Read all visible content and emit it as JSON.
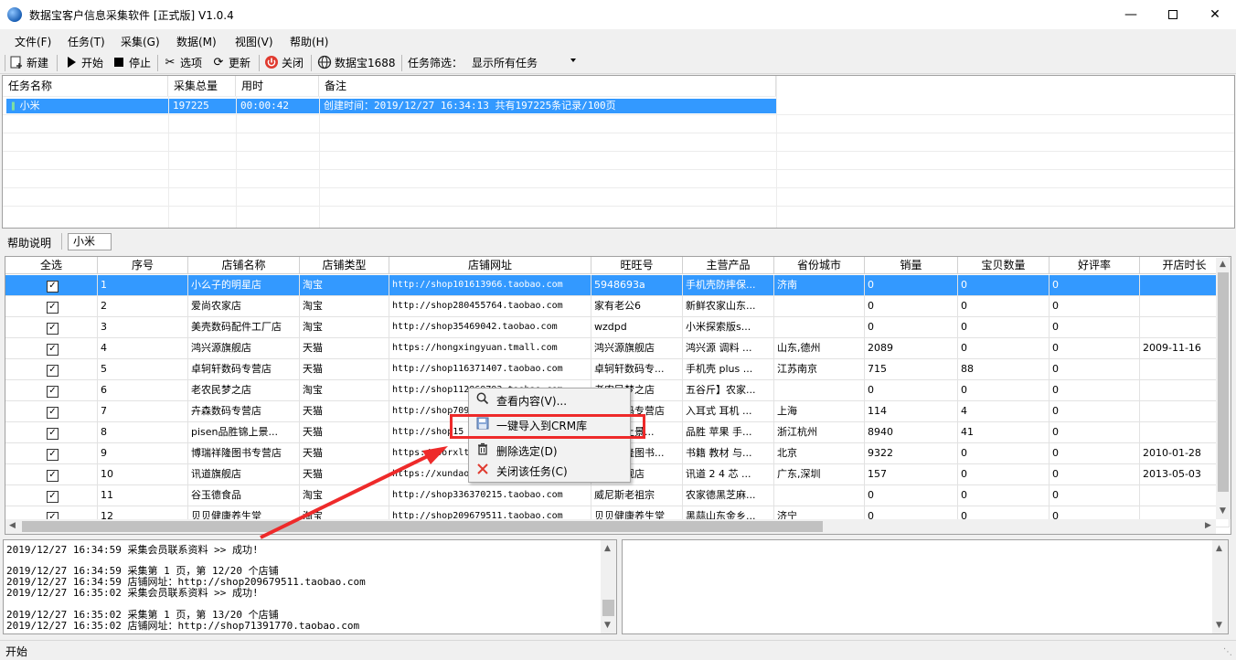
{
  "window": {
    "title": "数据宝客户信息采集软件 [正式版] V1.0.4"
  },
  "menu": [
    "文件(F)",
    "任务(T)",
    "采集(G)",
    "数据(M)",
    "视图(V)",
    "帮助(H)"
  ],
  "toolbar": {
    "new": "新建",
    "start": "开始",
    "stop": "停止",
    "options": "选项",
    "update": "更新",
    "close": "关闭",
    "site": "数据宝1688",
    "filter_label": "任务筛选：",
    "filter_value": "显示所有任务"
  },
  "task_table": {
    "headers": [
      "任务名称",
      "采集总量",
      "用时",
      "备注"
    ],
    "rows": [
      [
        "小米",
        "197225",
        "00:00:42",
        "创建时间：2019/12/27 16:34:13 共有197225条记录/100页"
      ]
    ]
  },
  "help": {
    "label": "帮助说明",
    "task": "小米"
  },
  "data_table": {
    "headers": [
      "全选",
      "序号",
      "店铺名称",
      "店铺类型",
      "店铺网址",
      "旺旺号",
      "主营产品",
      "省份城市",
      "销量",
      "宝贝数量",
      "好评率",
      "开店时长"
    ],
    "rows": [
      [
        "1",
        "小么子的明星店",
        "淘宝",
        "http://shop101613966.taobao.com",
        "5948693a",
        "手机壳防摔保...",
        "济南",
        "0",
        "0",
        "0",
        ""
      ],
      [
        "2",
        "爱尚农家店",
        "淘宝",
        "http://shop280455764.taobao.com",
        "家有老公6",
        "新鲜农家山东...",
        "",
        "0",
        "0",
        "0",
        ""
      ],
      [
        "3",
        "美壳数码配件工厂店",
        "淘宝",
        "http://shop35469042.taobao.com",
        "wzdpd",
        "小米探索版s...",
        "",
        "0",
        "0",
        "0",
        ""
      ],
      [
        "4",
        "鸿兴源旗舰店",
        "天猫",
        "https://hongxingyuan.tmall.com",
        "鸿兴源旗舰店",
        "鸿兴源 调料 ...",
        "山东,德州",
        "2089",
        "0",
        "0",
        "2009-11-16"
      ],
      [
        "5",
        "卓轲轩数码专营店",
        "天猫",
        "http://shop116371407.taobao.com",
        "卓轲轩数码专...",
        "手机壳 plus ...",
        "江苏南京",
        "715",
        "88",
        "0",
        ""
      ],
      [
        "6",
        "老农民梦之店",
        "淘宝",
        "http://shop112869793.taobao.com",
        "老农民梦之店",
        "五谷斤】农家...",
        "",
        "0",
        "0",
        "0",
        ""
      ],
      [
        "7",
        "卉森数码专营店",
        "天猫",
        "http://shop709",
        "卉森数码专营店",
        "入耳式 耳机 ...",
        "上海",
        "114",
        "4",
        "0",
        ""
      ],
      [
        "8",
        "pisen品胜锦上景...",
        "天猫",
        "http://shop15",
        "品胜锦上景...",
        "品胜 苹果 手...",
        "浙江杭州",
        "8940",
        "41",
        "0",
        ""
      ],
      [
        "9",
        "博瑞祥隆图书专营店",
        "天猫",
        "https://borxlts",
        "博瑞祥隆图书...",
        "书籍 教材 与...",
        "北京",
        "9322",
        "0",
        "0",
        "2010-01-28"
      ],
      [
        "10",
        "讯道旗舰店",
        "天猫",
        "https://xundao",
        "讯道旗舰店",
        "讯道 2 4 芯 ...",
        "广东,深圳",
        "157",
        "0",
        "0",
        "2013-05-03"
      ],
      [
        "11",
        "谷玉德食品",
        "淘宝",
        "http://shop336370215.taobao.com",
        "威尼斯老祖宗",
        "农家德黑芝麻...",
        "",
        "0",
        "0",
        "0",
        ""
      ],
      [
        "12",
        "贝贝健康养生堂",
        "淘宝",
        "http://shop209679511.taobao.com",
        "贝贝健康养生堂",
        "黑蒜山东金乡...",
        "济宁",
        "0",
        "0",
        "0",
        ""
      ]
    ]
  },
  "log": [
    "2019/12/27 16:34:59 采集会员联系资料 >> 成功!",
    "",
    "2019/12/27 16:34:59 采集第 1 页，第 12/20 个店铺",
    "2019/12/27 16:34:59 店铺网址：http://shop209679511.taobao.com",
    "2019/12/27 16:35:02 采集会员联系资料 >> 成功!",
    "",
    "2019/12/27 16:35:02 采集第 1 页，第 13/20 个店铺",
    "2019/12/27 16:35:02 店铺网址：http://shop71391770.taobao.com"
  ],
  "context_menu": [
    {
      "label": "查看内容(V)...",
      "icon": "magnifier-icon"
    },
    {
      "label": "一键导入到CRM库",
      "icon": "floppy-icon"
    },
    {
      "label": "删除选定(D)",
      "icon": "trash-icon"
    },
    {
      "label": "关闭该任务(C)",
      "icon": "close-x-icon"
    }
  ],
  "status": "开始",
  "colors": {
    "selection": "#3399ff",
    "highlight_box": "#ee2a2a",
    "arrow": "#ee2a2a"
  }
}
